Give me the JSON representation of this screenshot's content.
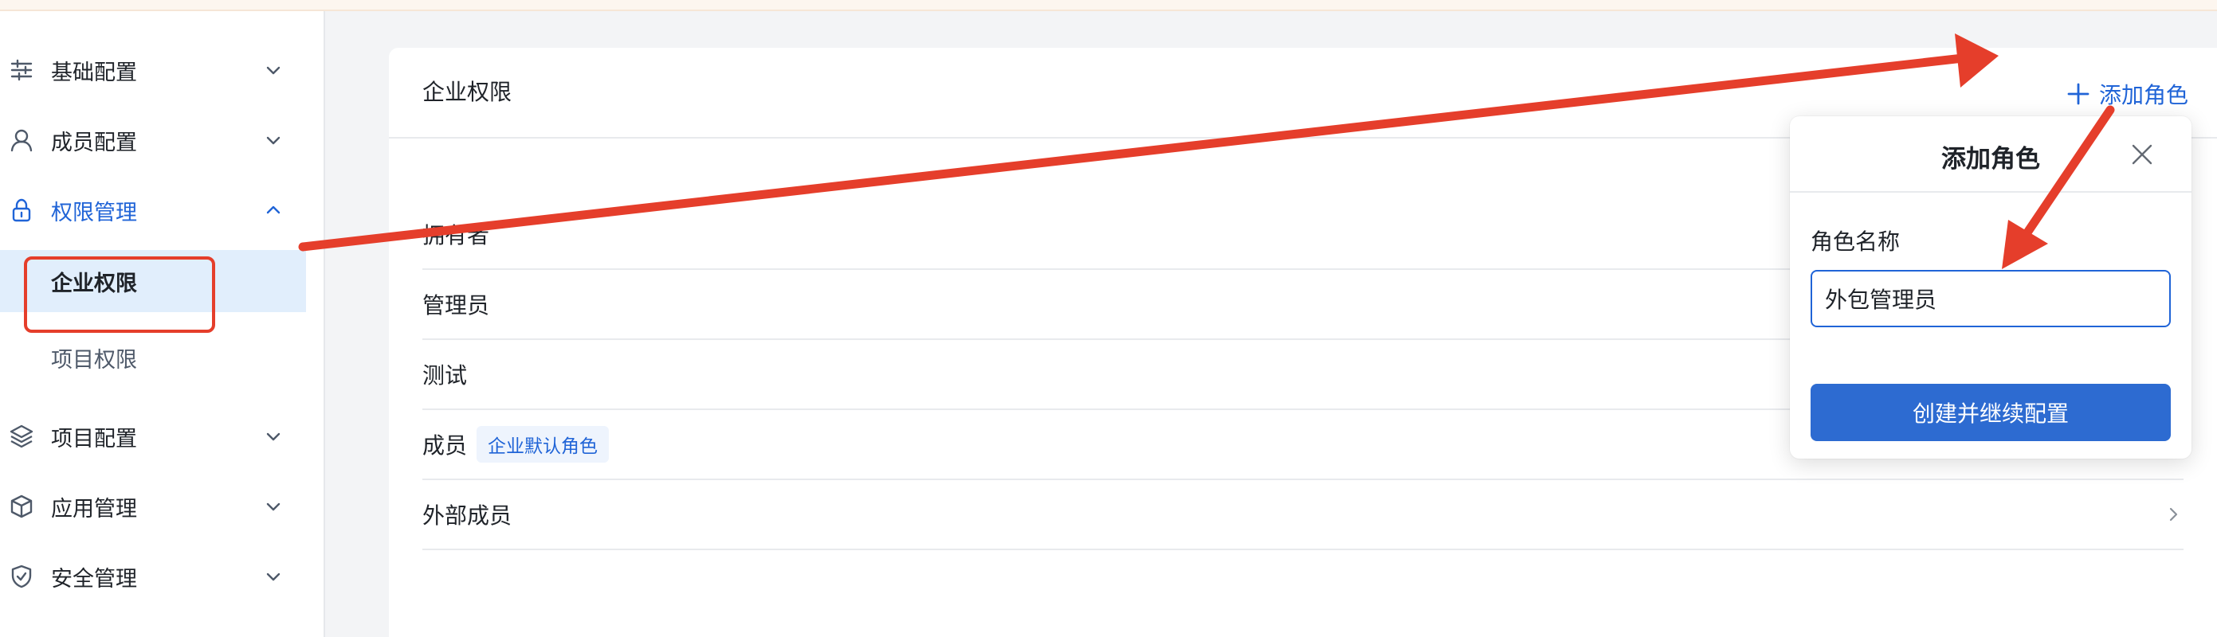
{
  "sidebar": {
    "items": [
      {
        "label": "基础配置",
        "icon": "sliders-icon",
        "expanded": false
      },
      {
        "label": "成员配置",
        "icon": "user-icon",
        "expanded": false
      },
      {
        "label": "权限管理",
        "icon": "lock-icon",
        "expanded": true,
        "active": true
      },
      {
        "label": "项目配置",
        "icon": "layers-icon",
        "expanded": false
      },
      {
        "label": "应用管理",
        "icon": "cube-icon",
        "expanded": false
      },
      {
        "label": "安全管理",
        "icon": "shield-check-icon",
        "expanded": false
      }
    ],
    "subitems": [
      {
        "label": "企业权限",
        "selected": true
      },
      {
        "label": "项目权限",
        "selected": false
      }
    ]
  },
  "main": {
    "title": "企业权限",
    "add_role_label": "添加角色",
    "roles": [
      {
        "name": "拥有者"
      },
      {
        "name": "管理员"
      },
      {
        "name": "测试"
      },
      {
        "name": "成员",
        "tag": "企业默认角色"
      },
      {
        "name": "外部成员"
      }
    ]
  },
  "popover": {
    "title": "添加角色",
    "field_label": "角色名称",
    "input_value": "外包管理员",
    "submit_label": "创建并继续配置"
  },
  "colors": {
    "accent": "#2064d7",
    "annotation": "#e53e2b",
    "selected_bg": "#e1eefc"
  }
}
